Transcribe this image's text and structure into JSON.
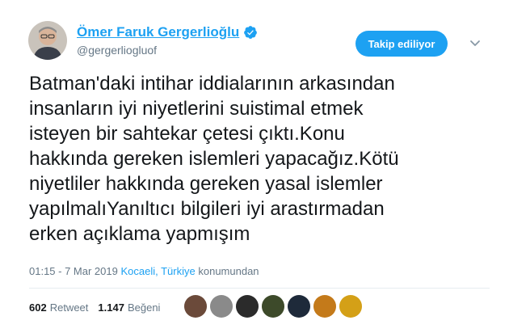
{
  "user": {
    "name": "Ömer Faruk Gergerlioğlu",
    "handle": "@gergerliogluof"
  },
  "follow_button": "Takip ediliyor",
  "tweet_text": "Batman'daki intihar iddialarının arkasından\ninsanların iyi niyetlerini suistimal etmek\nisteyen bir sahtekar çetesi çıktı.Konu\nhakkında gereken islemleri yapacağız.Kötü\nniyetliler hakkında gereken yasal islemler\nyapılmalıYanıltıcı bilgileri iyi arastırmadan\nerken açıklama yapmışım",
  "meta": {
    "time": "01:15 - 7 Mar 2019",
    "location": "Kocaeli, Türkiye",
    "location_suffix": "konumundan"
  },
  "stats": {
    "retweets": "602",
    "retweets_label": "Retweet",
    "likes": "1.147",
    "likes_label": "Beğeni"
  },
  "colors": {
    "accent": "#1da1f2",
    "text": "#14171a",
    "muted": "#657786"
  },
  "icons": {
    "verified": "verified-badge-icon",
    "chevron": "chevron-down-icon"
  },
  "likers": [
    "#6b4a3a",
    "#8a8a8a",
    "#2b2b2b",
    "#3d4a2a",
    "#1e2a3a",
    "#c47a1a",
    "#d4a017"
  ]
}
